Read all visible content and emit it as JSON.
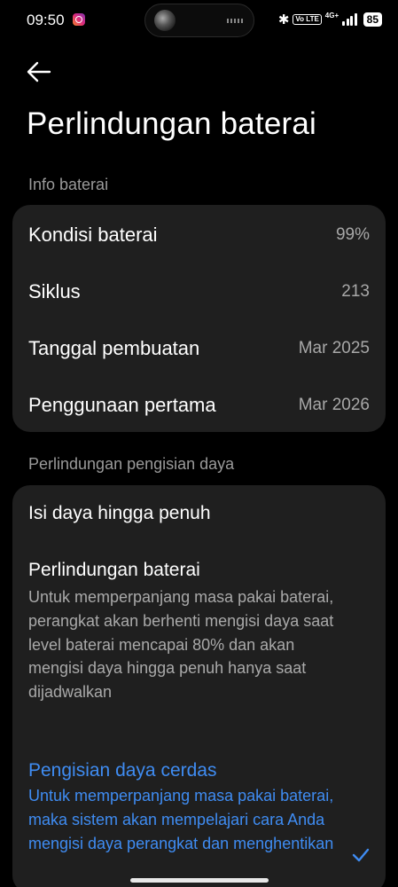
{
  "status_bar": {
    "time": "09:50",
    "battery": "85",
    "network": "4G+",
    "volte": "Vo LTE"
  },
  "header": {
    "title": "Perlindungan baterai"
  },
  "battery_info": {
    "section_title": "Info baterai",
    "rows": [
      {
        "label": "Kondisi baterai",
        "value": "99%"
      },
      {
        "label": "Siklus",
        "value": "213"
      },
      {
        "label": "Tanggal pembuatan",
        "value": "Mar 2025"
      },
      {
        "label": "Penggunaan pertama",
        "value": "Mar 2026"
      }
    ]
  },
  "charging_protection": {
    "section_title": "Perlindungan pengisian daya",
    "options": [
      {
        "title": "Isi daya hingga penuh",
        "description": "",
        "selected": false
      },
      {
        "title": "Perlindungan baterai",
        "description": "Untuk memperpanjang masa pakai baterai, perangkat akan berhenti mengisi daya saat level baterai mencapai 80% dan akan mengisi daya hingga penuh hanya saat dijadwalkan",
        "selected": false
      },
      {
        "title": "Pengisian daya cerdas",
        "description": "Untuk memperpanjang masa pakai baterai, maka sistem akan mempelajari cara Anda mengisi daya perangkat dan menghentikan",
        "selected": true
      }
    ]
  },
  "colors": {
    "background": "#000000",
    "card": "#1f1f1f",
    "accent": "#3f8cf2",
    "secondary_text": "#a9a9a9"
  }
}
